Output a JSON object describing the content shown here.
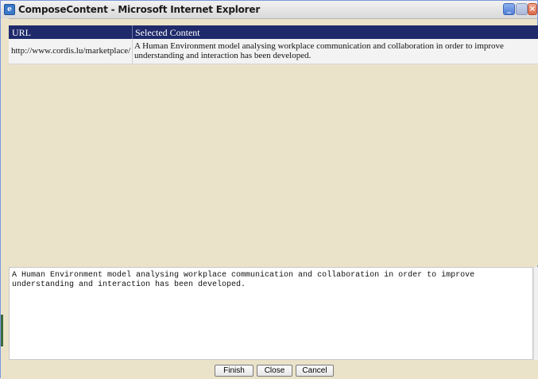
{
  "window": {
    "title": "ComposeContent - Microsoft Internet Explorer"
  },
  "grid": {
    "columns": [
      "URL",
      "Selected Content"
    ],
    "rows": [
      {
        "url": "http://www.cordis.lu/marketplace/",
        "content": "A Human Environment model analysing workplace communication and collaboration in order to improve understanding and interaction has been developed."
      }
    ]
  },
  "editor": {
    "text": "A Human Environment model analysing workplace communication and collaboration in order to improve\nunderstanding and interaction has been developed."
  },
  "buttons": {
    "finish": "Finish",
    "close": "Close",
    "cancel": "Cancel"
  }
}
